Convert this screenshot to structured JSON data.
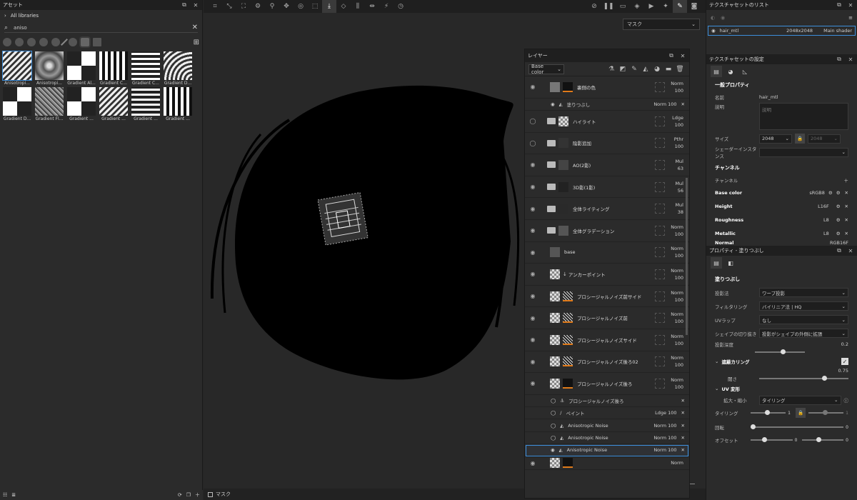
{
  "assets": {
    "title": "アセット",
    "all_libraries": "All libraries",
    "search_value": "aniso",
    "tiles": [
      {
        "label": "Anisotropi..."
      },
      {
        "label": "Anisotropi..."
      },
      {
        "label": "Gradient Al..."
      },
      {
        "label": "Gradient C..."
      },
      {
        "label": "Gradient C..."
      },
      {
        "label": "Gradient D..."
      },
      {
        "label": "Gradient D..."
      },
      {
        "label": "Gradient Fl..."
      },
      {
        "label": "Gradient ..."
      },
      {
        "label": "Gradient ..."
      },
      {
        "label": "Gradient ..."
      },
      {
        "label": "Gradient ..."
      }
    ]
  },
  "viewport": {
    "mask_dropdown": "マスク",
    "bottom_label": "マスク"
  },
  "layers": {
    "title": "レイヤー",
    "channel_select": "Base color",
    "rows": [
      {
        "name": "裏側の色",
        "blend": "Norm",
        "opacity": "100",
        "type": "fill"
      },
      {
        "name": "ハイライト",
        "blend": "Ldge",
        "opacity": "100",
        "type": "folder"
      },
      {
        "name": "陰影追加",
        "blend": "Pthr",
        "opacity": "100",
        "type": "folder"
      },
      {
        "name": "AO(2影)",
        "blend": "Mul",
        "opacity": "63",
        "type": "folder"
      },
      {
        "name": "3D影(1影)",
        "blend": "Mul",
        "opacity": "56",
        "type": "folder"
      },
      {
        "name": "全体ライティング",
        "blend": "Mul",
        "opacity": "38",
        "type": "folder"
      },
      {
        "name": "全体グラデーション",
        "blend": "Norm",
        "opacity": "100",
        "type": "folder"
      },
      {
        "name": "base",
        "blend": "Norm",
        "opacity": "100",
        "type": "plain"
      },
      {
        "name": "アンカーポイント",
        "blend": "Norm",
        "opacity": "100",
        "type": "anchor"
      },
      {
        "name": "プロシージャルノイズ前サイド",
        "blend": "Norm",
        "opacity": "100",
        "type": "noise"
      },
      {
        "name": "プロシージャルノイズ前",
        "blend": "Norm",
        "opacity": "100",
        "type": "noise"
      },
      {
        "name": "プロシージャルノイズサイド",
        "blend": "Norm",
        "opacity": "100",
        "type": "noise"
      },
      {
        "name": "プロシージャルノイズ後ろ02",
        "blend": "Norm",
        "opacity": "100",
        "type": "noise"
      },
      {
        "name": "プロシージャルノイズ後ろ",
        "blend": "Norm",
        "opacity": "100",
        "type": "black"
      }
    ],
    "fill_sub": {
      "name": "塗りつぶし",
      "blend": "Norm",
      "opacity": "100"
    },
    "subs": [
      {
        "name": "プロシージャルノイズ後ろ",
        "blend": "",
        "opacity": ""
      },
      {
        "name": "ペイント",
        "blend": "Ldge",
        "opacity": "100"
      },
      {
        "name": "Anisotropic Noise",
        "blend": "Norm",
        "opacity": "100"
      },
      {
        "name": "Anisotropic Noise",
        "blend": "Norm",
        "opacity": "100"
      },
      {
        "name": "Anisotropic Noise",
        "blend": "Norm",
        "opacity": "100"
      }
    ],
    "last_row_blend": "Norm"
  },
  "texset_list": {
    "title": "テクスチャセットのリスト",
    "name": "hair_mtl",
    "resolution": "2048x2048",
    "shader": "Main shader"
  },
  "texset_settings": {
    "title": "テクスチャセットの設定",
    "general_props": "一般プロパティ",
    "name_label": "名前",
    "name_value": "hair_mtl",
    "desc_label": "説明",
    "desc_placeholder": "説明",
    "size_label": "サイズ",
    "size_value": "2048",
    "size_value2": "2048",
    "shader_instance_label": "シェーダーインスタンス",
    "channels_section": "チャンネル",
    "channels_label": "チャンネル",
    "channels": [
      {
        "name": "Base color",
        "format": "sRGB8"
      },
      {
        "name": "Height",
        "format": "L16F"
      },
      {
        "name": "Roughness",
        "format": "L8"
      },
      {
        "name": "Metallic",
        "format": "L8"
      },
      {
        "name": "Normal",
        "format": "RGB16F"
      }
    ]
  },
  "fill_props": {
    "title": "プロパティ - 塗りつぶし",
    "section": "塗りつぶし",
    "projection_label": "投影法",
    "projection_value": "ワープ投影",
    "filtering_label": "フィルタリング",
    "filtering_value": "バイリニア法 | HQ",
    "uv_wrap_label": "UVラップ",
    "uv_wrap_value": "なし",
    "shape_crop_label": "シェイプの切り抜き",
    "shape_crop_value": "投影がシェイプの外側に拡張",
    "depth_label": "投影深度",
    "depth_value": "0.2",
    "occlusion_label": "遮蔽カリング",
    "threshold_label": "閾さ",
    "threshold_value": "0.75",
    "uv_transform_label": "UV 変形",
    "scale_label": "拡大・縮小",
    "scale_value": "タイリング",
    "tiling_label": "タイリング",
    "tiling_value1": "1",
    "tiling_value2": "1",
    "rotation_label": "回転",
    "rotation_value": "0",
    "offset_label": "オフセット",
    "offset_value1": "0",
    "offset_value2": "0"
  },
  "colors": {
    "accent": "#3d8edb",
    "orange": "#e07b1a"
  }
}
